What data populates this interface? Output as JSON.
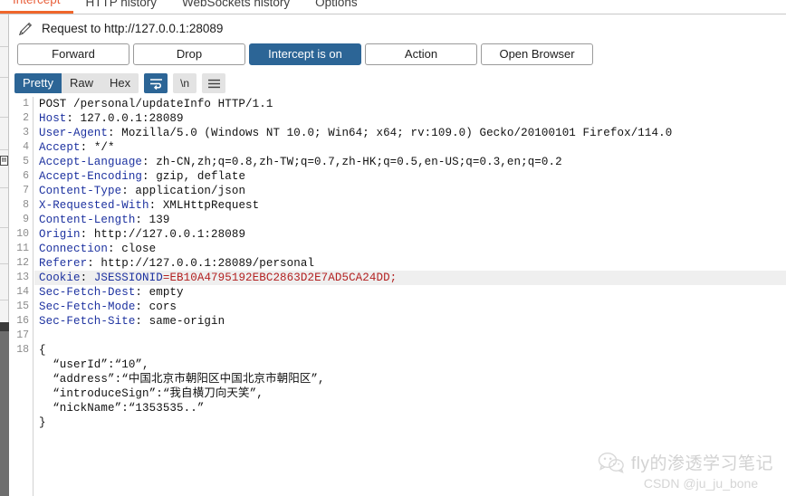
{
  "tabs": [
    {
      "label": "Intercept",
      "active": true
    },
    {
      "label": "HTTP history",
      "active": false
    },
    {
      "label": "WebSockets history",
      "active": false
    },
    {
      "label": "Options",
      "active": false
    }
  ],
  "request_header": {
    "icon": "pencil-icon",
    "title": "Request to http://127.0.0.1:28089"
  },
  "actions": [
    {
      "label": "Forward",
      "style": "default"
    },
    {
      "label": "Drop",
      "style": "default"
    },
    {
      "label": "Intercept is on",
      "style": "primary"
    },
    {
      "label": "Action",
      "style": "default"
    },
    {
      "label": "Open Browser",
      "style": "default"
    }
  ],
  "view_modes": [
    {
      "label": "Pretty",
      "active": true
    },
    {
      "label": "Raw",
      "active": false
    },
    {
      "label": "Hex",
      "active": false
    }
  ],
  "view_icons": [
    {
      "name": "word-wrap-icon",
      "label": "",
      "active": true
    },
    {
      "name": "newline-icon",
      "label": "\\n",
      "active": false
    },
    {
      "name": "menu-icon",
      "label": "",
      "active": false
    }
  ],
  "colors": {
    "accent_blue": "#2c6596",
    "tab_active": "#f0662b",
    "header_name": "#1d32a0",
    "cookie_value": "#b32222",
    "json_body": "#2f8f46",
    "gutter_text": "#8c8c8c"
  },
  "editor": {
    "line_numbers": [
      1,
      2,
      3,
      4,
      5,
      6,
      7,
      8,
      9,
      10,
      11,
      12,
      13,
      14,
      15,
      16,
      17,
      18
    ],
    "lines": [
      {
        "n": 1,
        "type": "request-line",
        "text": "POST /personal/updateInfo HTTP/1.1"
      },
      {
        "n": 2,
        "type": "header",
        "name": "Host",
        "value": "127.0.0.1:28089"
      },
      {
        "n": 3,
        "type": "header",
        "name": "User-Agent",
        "value": "Mozilla/5.0 (Windows NT 10.0; Win64; x64; rv:109.0) Gecko/20100101 Firefox/114.0"
      },
      {
        "n": 4,
        "type": "header",
        "name": "Accept",
        "value": "*/*"
      },
      {
        "n": 5,
        "type": "header",
        "name": "Accept-Language",
        "value": "zh-CN,zh;q=0.8,zh-TW;q=0.7,zh-HK;q=0.5,en-US;q=0.3,en;q=0.2"
      },
      {
        "n": 6,
        "type": "header",
        "name": "Accept-Encoding",
        "value": "gzip, deflate"
      },
      {
        "n": 7,
        "type": "header",
        "name": "Content-Type",
        "value": "application/json"
      },
      {
        "n": 8,
        "type": "header",
        "name": "X-Requested-With",
        "value": "XMLHttpRequest"
      },
      {
        "n": 9,
        "type": "header",
        "name": "Content-Length",
        "value": "139"
      },
      {
        "n": 10,
        "type": "header",
        "name": "Origin",
        "value": "http://127.0.0.1:28089"
      },
      {
        "n": 11,
        "type": "header",
        "name": "Connection",
        "value": "close"
      },
      {
        "n": 12,
        "type": "header",
        "name": "Referer",
        "value": "http://127.0.0.1:28089/personal"
      },
      {
        "n": 13,
        "type": "cookie",
        "name": "Cookie",
        "cookie_name": "JSESSIONID",
        "cookie_value": "EB10A4795192EBC2863D2E7AD5CA24DD;",
        "highlighted": true
      },
      {
        "n": 14,
        "type": "header",
        "name": "Sec-Fetch-Dest",
        "value": "empty"
      },
      {
        "n": 15,
        "type": "header",
        "name": "Sec-Fetch-Mode",
        "value": "cors"
      },
      {
        "n": 16,
        "type": "header",
        "name": "Sec-Fetch-Site",
        "value": "same-origin"
      },
      {
        "n": 17,
        "type": "blank",
        "text": ""
      },
      {
        "n": 18,
        "type": "body-open",
        "text": "{"
      }
    ],
    "body_lines": [
      "  “userId”:“10”,",
      "  “address”:“中国北京市朝阳区中国北京市朝阳区”,",
      "  “introduceSign”:“我自横刀向天笑”,",
      "  “nickName”:“1353535..”",
      "}"
    ]
  },
  "watermark": {
    "icon": "wechat-icon",
    "text": "fly的渗透学习笔记",
    "subtext": "CSDN @ju_ju_bone"
  }
}
